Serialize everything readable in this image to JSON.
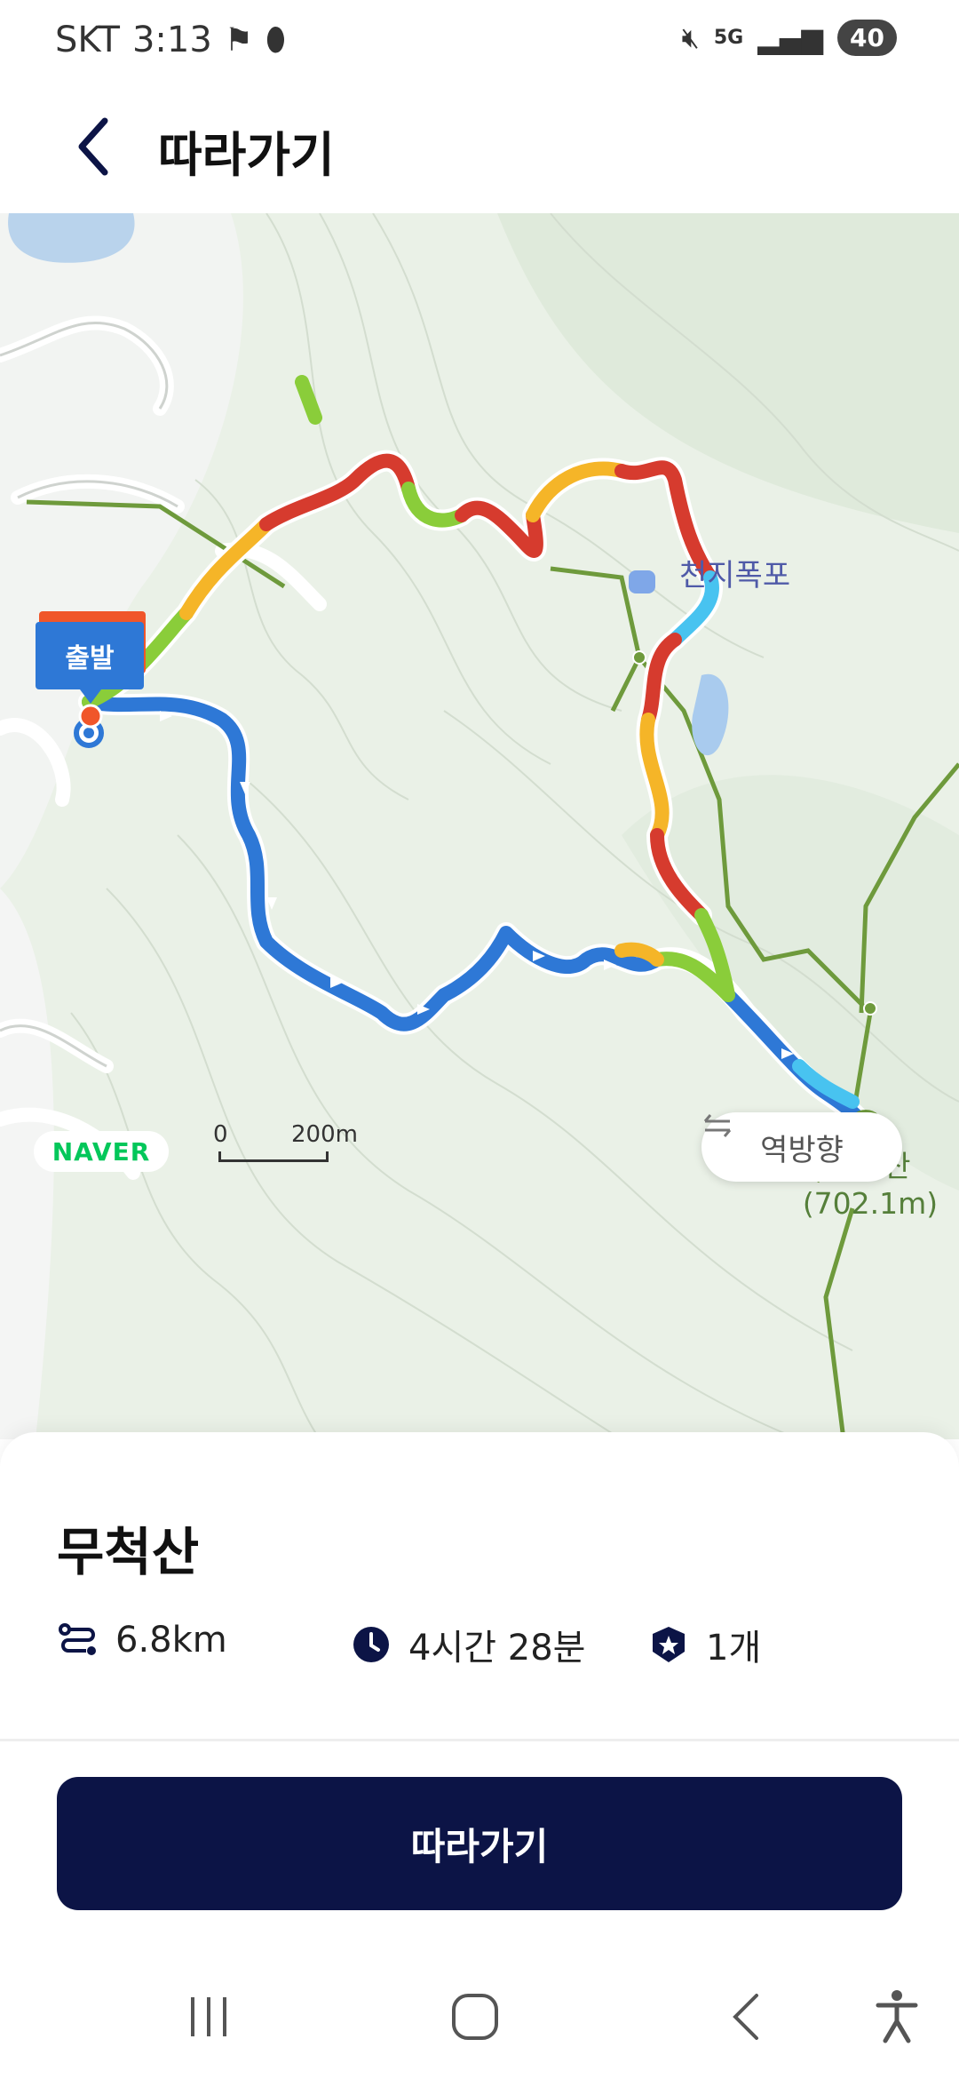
{
  "status_bar": {
    "carrier": "SKT",
    "time": "3:13",
    "battery": "40",
    "network": "5G"
  },
  "header": {
    "title": "따라가기"
  },
  "map": {
    "start_marker_label": "출발",
    "poi_label": "천지폭포",
    "peak_name": "무척산",
    "peak_elevation": "(702.1m)",
    "provider": "NAVER",
    "scale_start": "0",
    "scale_end": "200m",
    "reverse_button_label": "역방향"
  },
  "route": {
    "name": "무척산",
    "distance": "6.8km",
    "duration": "4시간 28분",
    "badge_count": "1개"
  },
  "actions": {
    "follow_label": "따라가기"
  },
  "colors": {
    "primary_button": "#0c1446",
    "trail_slow": "#d63b2e",
    "trail_fast": "#2e78d6",
    "trail_mid": "#8acd3a",
    "trail_yellow": "#f5b528",
    "trail_cyan": "#48c3f0",
    "hiking_path": "#6e9a3c"
  }
}
